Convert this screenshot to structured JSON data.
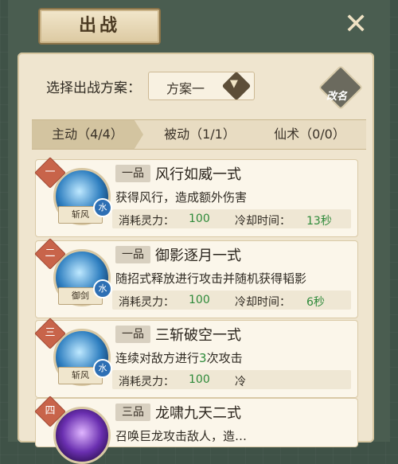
{
  "header": {
    "title": "出战",
    "close_icon": "close-x-icon"
  },
  "plan": {
    "label": "选择出战方案：",
    "selected": "方案一",
    "rename_label": "改名"
  },
  "tabs": [
    {
      "label": "主动（4/4）",
      "active": true
    },
    {
      "label": "被动（1/1）",
      "active": false
    },
    {
      "label": "仙术（0/0）",
      "active": false
    }
  ],
  "stat_labels": {
    "cost": "消耗灵力：",
    "cooldown": "冷却时间："
  },
  "skills": [
    {
      "rank": "一",
      "grade": "一品",
      "name": "风行如威一式",
      "tag": "斩风",
      "element": "水",
      "desc": "获得风行，造成额外伤害",
      "desc_pre": "",
      "desc_hl": "",
      "desc_post": "",
      "cost": "100",
      "cooldown": "13秒"
    },
    {
      "rank": "二",
      "grade": "一品",
      "name": "御影逐月一式",
      "tag": "御剑",
      "element": "水",
      "desc": "随招式释放进行攻击并随机获得韬影",
      "cost": "100",
      "cooldown": "6秒"
    },
    {
      "rank": "三",
      "grade": "一品",
      "name": "三斩破空一式",
      "tag": "斩风",
      "element": "水",
      "desc_pre": "连续对敌方进行",
      "desc_hl": "3",
      "desc_post": "次攻击",
      "cost": "100",
      "cooldown": "冷"
    },
    {
      "rank": "四",
      "grade": "三品",
      "name": "龙啸九天二式",
      "tag": "",
      "element": "",
      "desc": "召唤巨龙攻击敌人，造…"
    }
  ],
  "colors": {
    "accent_green": "#2e8a3a",
    "rank_red": "#c8644a",
    "water_blue": "#2d6fb4"
  }
}
